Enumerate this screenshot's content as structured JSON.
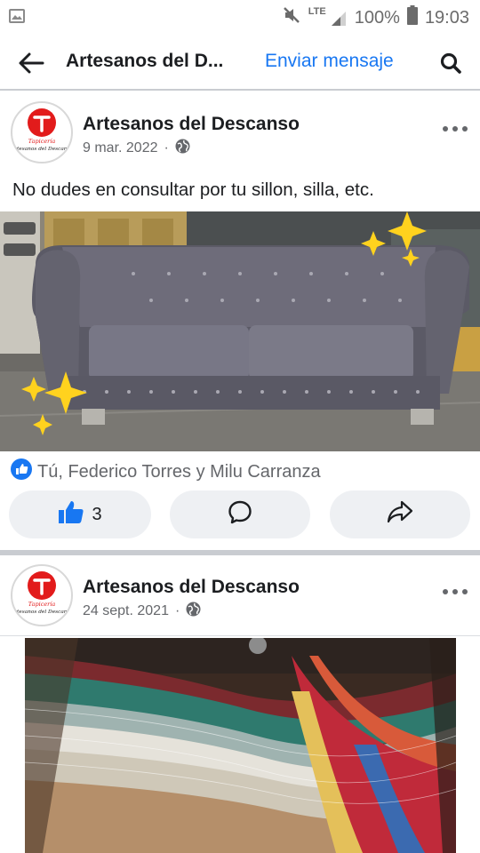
{
  "status_bar": {
    "network": "LTE",
    "battery": "100%",
    "time": "19:03"
  },
  "header": {
    "title": "Artesanos del D...",
    "send_message": "Enviar mensaje"
  },
  "posts": [
    {
      "author": "Artesanos del Descanso",
      "date": "9 mar. 2022",
      "separator": "·",
      "text": "No dudes en consultar por tu sillon, silla, etc.",
      "reactions_text": "Tú, Federico Torres y Milu Carranza",
      "like_count": "3"
    },
    {
      "author": "Artesanos del Descanso",
      "date": "24 sept. 2021",
      "separator": "·"
    }
  ],
  "avatar_logo": {
    "letter": "T",
    "line1": "Tapicería",
    "line2": "Artesanos del Descanso"
  },
  "colors": {
    "brand_blue": "#1877f2",
    "logo_red": "#e21b1b",
    "pill_bg": "#eef0f3",
    "divider": "#c9ccd1"
  },
  "icons": [
    "picture-icon",
    "mute-icon",
    "signal-icon",
    "battery-icon",
    "back-arrow-icon",
    "search-icon",
    "more-icon",
    "globe-icon",
    "like-reaction-icon",
    "like-icon",
    "comment-icon",
    "share-icon"
  ]
}
